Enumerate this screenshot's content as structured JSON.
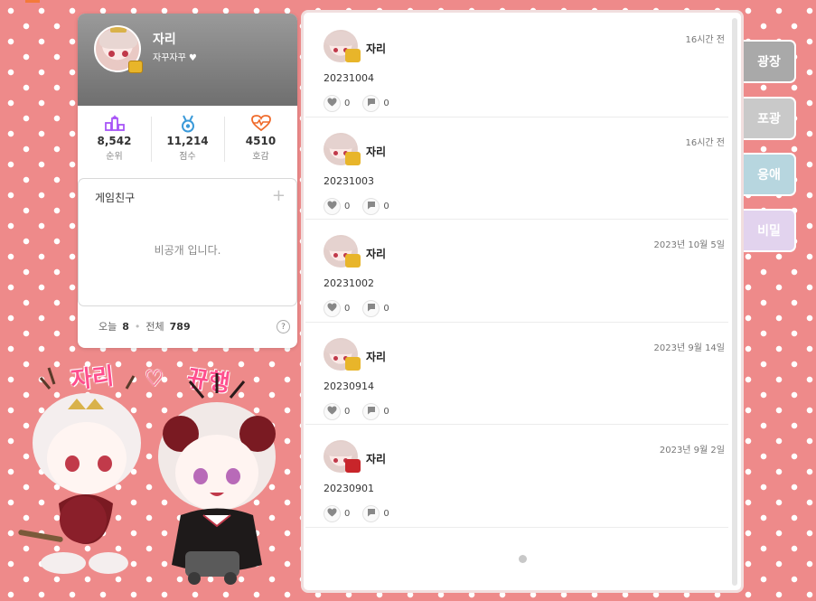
{
  "profile": {
    "name": "자리",
    "subtitle": "자꾸자꾸",
    "stats": [
      {
        "value": "8,542",
        "label": "순위",
        "icon": "podium-icon"
      },
      {
        "value": "11,214",
        "label": "점수",
        "icon": "medal-icon"
      },
      {
        "value": "4510",
        "label": "호감",
        "icon": "heart-pulse-icon"
      }
    ]
  },
  "friends": {
    "title": "게임친구",
    "add_label": "+",
    "private_text": "비공개 입니다."
  },
  "visits": {
    "today_label": "오늘",
    "today_value": "8",
    "total_label": "전체",
    "total_value": "789",
    "help_label": "?"
  },
  "feed": {
    "posts": [
      {
        "author": "자리",
        "time": "16시간 전",
        "text": "20231004",
        "likes": "0",
        "comments": "0"
      },
      {
        "author": "자리",
        "time": "16시간 전",
        "text": "20231003",
        "likes": "0",
        "comments": "0"
      },
      {
        "author": "자리",
        "time": "2023년 10월 5일",
        "text": "20231002",
        "likes": "0",
        "comments": "0"
      },
      {
        "author": "자리",
        "time": "2023년 9월 14일",
        "text": "20230914",
        "likes": "0",
        "comments": "0"
      },
      {
        "author": "자리",
        "time": "2023년 9월 2일",
        "text": "20230901",
        "likes": "0",
        "comments": "0"
      }
    ]
  },
  "side_tabs": [
    {
      "label": "광장",
      "color": "#a9a9a9"
    },
    {
      "label": "포광",
      "color": "#c9c9c9"
    },
    {
      "label": "응애",
      "color": "#b7d6df"
    },
    {
      "label": "비밀",
      "color": "#e2d3ee"
    }
  ],
  "illustration": {
    "left_name": "자리",
    "heart": "♡",
    "right_name": "뀨행"
  },
  "colors": {
    "accent_orange": "#f47a3a",
    "background_pink": "#ee8a8a",
    "title_pink": "#ff4f8e",
    "rank_icon": "#a855f7",
    "score_icon": "#3b9ad9",
    "like_icon": "#f06a2a"
  }
}
